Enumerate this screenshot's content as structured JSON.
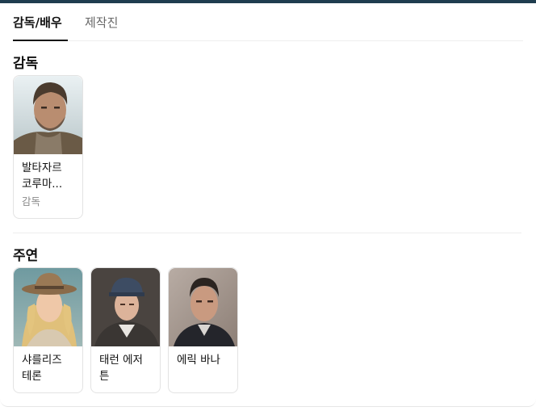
{
  "tabs": [
    {
      "label": "감독/배우",
      "active": true
    },
    {
      "label": "제작진",
      "active": false
    }
  ],
  "sections": {
    "director": {
      "title": "감독",
      "people": [
        {
          "name_line1": "발타자르",
          "name_line2": "코루마...",
          "role": "감독"
        }
      ]
    },
    "cast": {
      "title": "주연",
      "people": [
        {
          "name_line1": "샤를리즈",
          "name_line2": "테론",
          "role": ""
        },
        {
          "name_line1": "태런 에저",
          "name_line2": "튼",
          "role": ""
        },
        {
          "name_line1": "에릭 바나",
          "name_line2": "",
          "role": ""
        }
      ]
    }
  },
  "colors": {
    "top_bar": "#1f3d4f",
    "active_tab_text": "#111111",
    "inactive_tab_text": "#666666",
    "role_text": "#8a8a8a",
    "card_border": "#e3e3e3"
  }
}
